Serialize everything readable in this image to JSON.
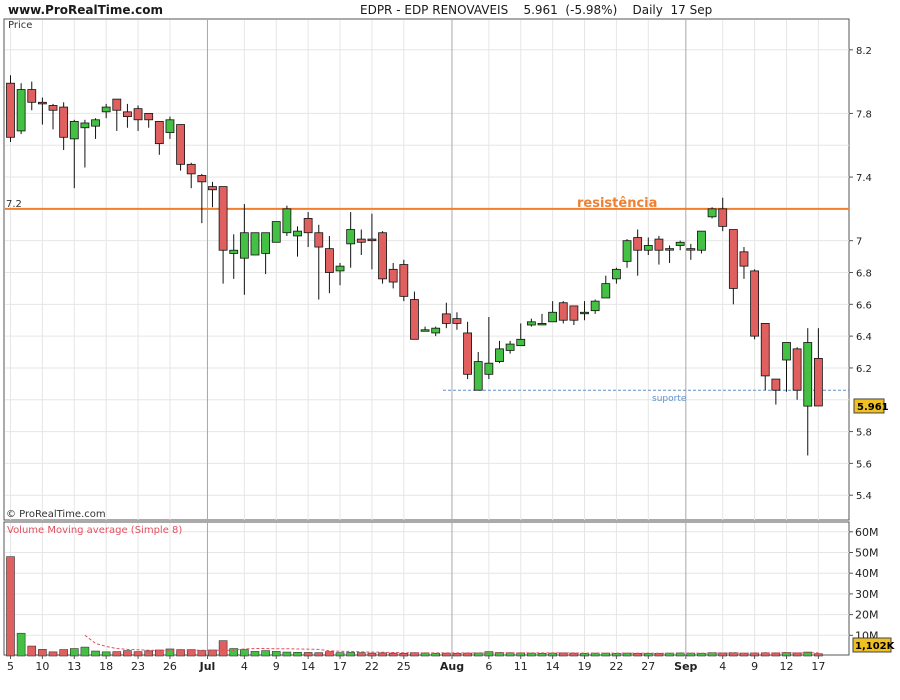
{
  "header": {
    "site": "www.ProRealTime.com",
    "title": "EDPR - EDP RENOVAVEIS    5.961  (-5.98%)    Daily  17 Sep"
  },
  "price_panel": {
    "label": "Price",
    "watermark": "© ProRealTime.com",
    "left_level_label": "7.2",
    "current_price_label": "5.961"
  },
  "volume_panel": {
    "label": "Volume Moving average (Simple 8)",
    "current_volume_label": "1,102K"
  },
  "annotations": {
    "resistance": "resistência",
    "support": "suporte"
  },
  "colors": {
    "up": "#44c044",
    "down": "#e06060",
    "resistance_line": "#f08030",
    "support_line": "#6090c8",
    "grid": "#e6e6e6",
    "month_line": "#a8a8a8",
    "current_box": "#f0c020",
    "ma_line": "#e05060"
  },
  "chart_data": [
    {
      "type": "candlestick",
      "title": "EDPR - EDP RENOVAVEIS",
      "subtitle": "Daily 17 Sep",
      "ylabel": "Price",
      "ylim": [
        5.3,
        8.3
      ],
      "y_ticks": [
        "8.2",
        "7.8",
        "7.4",
        "7",
        "6.8",
        "6.6",
        "6.4",
        "6.2",
        "5.8",
        "5.6",
        "5.4"
      ],
      "x_ticks": [
        "5",
        "10",
        "13",
        "18",
        "23",
        "26",
        "Jul",
        "4",
        "9",
        "14",
        "17",
        "22",
        "25",
        "Aug",
        "6",
        "11",
        "14",
        "19",
        "22",
        "27",
        "Sep",
        "4",
        "9",
        "12",
        "17"
      ],
      "month_separators": [
        "Jul",
        "Aug",
        "Sep"
      ],
      "resistance_level": 7.2,
      "support_level": 6.06,
      "last_close": 5.961,
      "last_change_pct": -5.98,
      "ohlc": [
        [
          7.99,
          8.04,
          7.62,
          7.65
        ],
        [
          7.69,
          7.99,
          7.67,
          7.95
        ],
        [
          7.95,
          8.0,
          7.82,
          7.87
        ],
        [
          7.87,
          7.9,
          7.73,
          7.86
        ],
        [
          7.85,
          7.86,
          7.7,
          7.82
        ],
        [
          7.84,
          7.87,
          7.57,
          7.65
        ],
        [
          7.64,
          7.76,
          7.33,
          7.75
        ],
        [
          7.71,
          7.76,
          7.46,
          7.74
        ],
        [
          7.72,
          7.77,
          7.64,
          7.76
        ],
        [
          7.81,
          7.86,
          7.77,
          7.84
        ],
        [
          7.89,
          7.89,
          7.69,
          7.82
        ],
        [
          7.81,
          7.86,
          7.71,
          7.78
        ],
        [
          7.83,
          7.85,
          7.69,
          7.76
        ],
        [
          7.8,
          7.8,
          7.71,
          7.76
        ],
        [
          7.75,
          7.75,
          7.54,
          7.61
        ],
        [
          7.68,
          7.78,
          7.64,
          7.76
        ],
        [
          7.73,
          7.73,
          7.44,
          7.48
        ],
        [
          7.48,
          7.49,
          7.33,
          7.42
        ],
        [
          7.41,
          7.42,
          7.11,
          7.37
        ],
        [
          7.34,
          7.37,
          7.21,
          7.32
        ],
        [
          7.34,
          7.34,
          6.73,
          6.94
        ],
        [
          6.92,
          7.04,
          6.76,
          6.94
        ],
        [
          6.89,
          7.23,
          6.66,
          7.05
        ],
        [
          6.91,
          7.03,
          6.91,
          7.05
        ],
        [
          6.92,
          7.03,
          6.79,
          7.05
        ],
        [
          6.99,
          7.12,
          6.99,
          7.12
        ],
        [
          7.05,
          7.22,
          7.03,
          7.2
        ],
        [
          7.03,
          7.09,
          6.9,
          7.06
        ],
        [
          7.14,
          7.18,
          6.96,
          7.05
        ],
        [
          7.05,
          7.1,
          6.63,
          6.96
        ],
        [
          6.95,
          7.03,
          6.67,
          6.8
        ],
        [
          6.81,
          6.86,
          6.72,
          6.84
        ],
        [
          6.98,
          7.18,
          6.83,
          7.07
        ],
        [
          7.01,
          7.07,
          6.91,
          6.99
        ],
        [
          7.01,
          7.17,
          6.82,
          7.0
        ],
        [
          7.05,
          7.06,
          6.73,
          6.76
        ],
        [
          6.82,
          6.86,
          6.7,
          6.74
        ],
        [
          6.85,
          6.88,
          6.62,
          6.65
        ],
        [
          6.63,
          6.68,
          6.38,
          6.38
        ],
        [
          6.44,
          6.46,
          6.43,
          6.44
        ],
        [
          6.42,
          6.46,
          6.4,
          6.45
        ],
        [
          6.54,
          6.61,
          6.45,
          6.48
        ],
        [
          6.51,
          6.55,
          6.44,
          6.48
        ],
        [
          6.42,
          6.49,
          6.13,
          6.16
        ],
        [
          6.06,
          6.3,
          6.06,
          6.24
        ],
        [
          6.16,
          6.52,
          6.13,
          6.23
        ],
        [
          6.24,
          6.37,
          6.23,
          6.32
        ],
        [
          6.31,
          6.37,
          6.29,
          6.35
        ],
        [
          6.34,
          6.48,
          6.34,
          6.38
        ],
        [
          6.47,
          6.51,
          6.46,
          6.49
        ],
        [
          6.48,
          6.54,
          6.47,
          6.48
        ],
        [
          6.49,
          6.62,
          6.49,
          6.55
        ],
        [
          6.61,
          6.62,
          6.48,
          6.5
        ],
        [
          6.59,
          6.59,
          6.47,
          6.5
        ],
        [
          6.55,
          6.62,
          6.5,
          6.55
        ],
        [
          6.56,
          6.63,
          6.54,
          6.62
        ],
        [
          6.64,
          6.78,
          6.64,
          6.73
        ],
        [
          6.76,
          6.83,
          6.73,
          6.82
        ],
        [
          6.87,
          7.01,
          6.83,
          7.0
        ],
        [
          7.02,
          7.07,
          6.78,
          6.94
        ],
        [
          6.94,
          7.02,
          6.91,
          6.97
        ],
        [
          7.01,
          7.03,
          6.85,
          6.94
        ],
        [
          6.95,
          6.97,
          6.86,
          6.95
        ],
        [
          6.97,
          7.0,
          6.94,
          6.99
        ],
        [
          6.95,
          6.98,
          6.88,
          6.95
        ],
        [
          6.94,
          7.06,
          6.92,
          7.06
        ],
        [
          7.15,
          7.21,
          7.14,
          7.2
        ],
        [
          7.2,
          7.27,
          7.06,
          7.09
        ],
        [
          7.07,
          7.07,
          6.6,
          6.7
        ],
        [
          6.93,
          6.96,
          6.76,
          6.84
        ],
        [
          6.81,
          6.82,
          6.38,
          6.4
        ],
        [
          6.48,
          6.48,
          6.06,
          6.15
        ],
        [
          6.13,
          6.13,
          5.97,
          6.06
        ],
        [
          6.25,
          6.36,
          6.05,
          6.36
        ],
        [
          6.32,
          6.33,
          6.0,
          6.06
        ],
        [
          5.96,
          6.45,
          5.65,
          6.36
        ],
        [
          6.26,
          6.45,
          5.97,
          5.961
        ]
      ]
    },
    {
      "type": "bar",
      "title": "Volume Moving average (Simple 8)",
      "ylim": [
        0,
        65
      ],
      "y_ticks": [
        "60M",
        "50M",
        "40M",
        "30M",
        "20M",
        "10M"
      ],
      "unit": "M",
      "volumes": [
        48,
        11,
        4.8,
        3.2,
        2,
        3.1,
        3.6,
        4.3,
        2.4,
        2,
        2.1,
        2.6,
        2.1,
        2.5,
        2.9,
        3.4,
        3.1,
        3.1,
        2.6,
        2.9,
        7.4,
        3.6,
        3.1,
        2.2,
        2.6,
        2.2,
        1.9,
        1.8,
        1.7,
        1.6,
        2.1,
        1.6,
        1.7,
        1.6,
        1.4,
        1.5,
        1.4,
        1.3,
        1.6,
        1.5,
        1.3,
        1.4,
        1.3,
        1.4,
        1.5,
        2.1,
        1.7,
        1.6,
        1.5,
        1.4,
        1.3,
        1.4,
        1.5,
        1.4,
        1.3,
        1.4,
        1.4,
        1.3,
        1.4,
        1.3,
        1.2,
        1.3,
        1.4,
        1.5,
        1.4,
        1.3,
        1.6,
        1.5,
        1.6,
        1.4,
        1.5,
        1.6,
        1.5,
        1.7,
        1.5,
        1.9,
        1.102
      ],
      "moving_average": {
        "name": "Volume Moving average (Simple 8)",
        "start_index": 7,
        "values": [
          10.0,
          6.1,
          4.6,
          3.6,
          3.2,
          3.0,
          2.8,
          2.7,
          2.7,
          2.8,
          2.8,
          2.8,
          2.8,
          2.8,
          2.8,
          3.4,
          3.6,
          3.6,
          3.5,
          3.5,
          3.4,
          3.3,
          3.2,
          2.5,
          2.3,
          2.2,
          2.0,
          1.9,
          1.8,
          1.7,
          1.6,
          1.6,
          1.5,
          1.5,
          1.5,
          1.5,
          1.5,
          1.4,
          1.4,
          1.5,
          1.5,
          1.5,
          1.5,
          1.5,
          1.5,
          1.5,
          1.5,
          1.4,
          1.4,
          1.4,
          1.4,
          1.4,
          1.4,
          1.4,
          1.3,
          1.3,
          1.3,
          1.4,
          1.4,
          1.4,
          1.4,
          1.4,
          1.4,
          1.4,
          1.5,
          1.5,
          1.5,
          1.5,
          1.5,
          1.6
        ]
      }
    }
  ]
}
